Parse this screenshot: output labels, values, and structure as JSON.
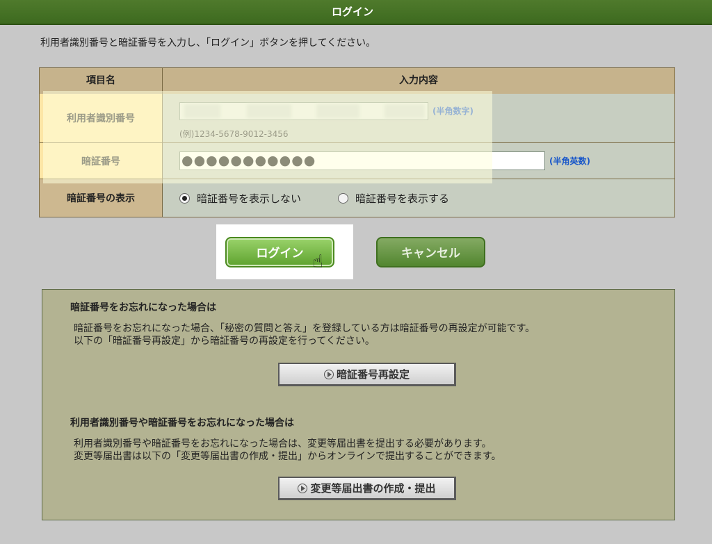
{
  "window": {
    "title": "ログイン"
  },
  "instruction": "利用者識別番号と暗証番号を入力し、「ログイン」ボタンを押してください。",
  "table": {
    "header_item": "項目名",
    "header_input": "入力内容",
    "rows": [
      {
        "label": "利用者識別番号",
        "hint": "(半角数字)",
        "example": "(例)1234-5678-9012-3456"
      },
      {
        "label": "暗証番号",
        "value": "●●●●●●●●●●●",
        "hint": "(半角英数)"
      },
      {
        "label": "暗証番号の表示",
        "options": [
          {
            "label": "暗証番号を表示しない",
            "selected": true
          },
          {
            "label": "暗証番号を表示する",
            "selected": false
          }
        ]
      }
    ]
  },
  "buttons": {
    "login": "ログイン",
    "cancel": "キャンセル"
  },
  "help": {
    "pin": {
      "heading": "暗証番号をお忘れになった場合は",
      "line1": "暗証番号をお忘れになった場合、「秘密の質問と答え」を登録している方は暗証番号の再設定が可能です。",
      "line2": "以下の「暗証番号再設定」から暗証番号の再設定を行ってください。",
      "button": "暗証番号再設定"
    },
    "both": {
      "heading": "利用者識別番号や暗証番号をお忘れになった場合は",
      "line1": "利用者識別番号や暗証番号をお忘れになった場合は、変更等届出書を提出する必要があります。",
      "line2": "変更等届出書は以下の「変更等届出書の作成・提出」からオンラインで提出することができます。",
      "button": "変更等届出書の作成・提出"
    }
  },
  "colors": {
    "header_bar": "#3d6a1f",
    "login_button": "#5ea22e",
    "hint_blue": "#1a58c9"
  }
}
